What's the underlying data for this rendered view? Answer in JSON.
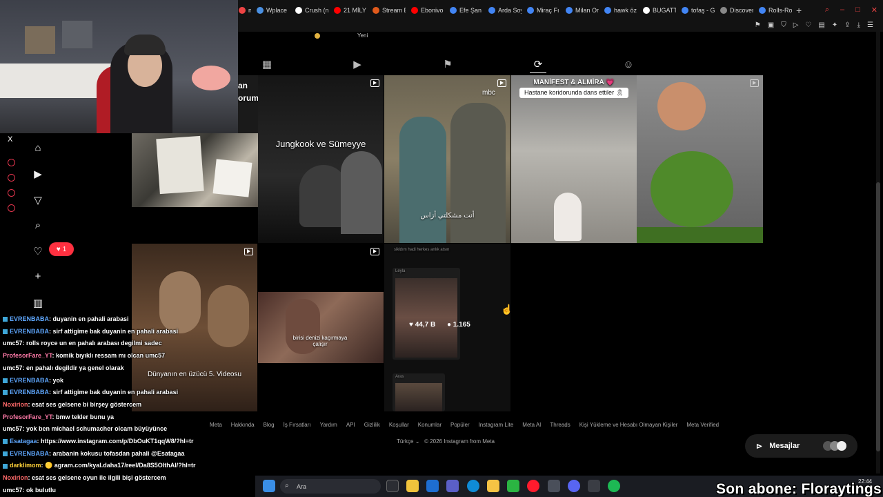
{
  "browser": {
    "tabs": [
      {
        "label": "na S",
        "color": "#e44"
      },
      {
        "label": "Wplace",
        "color": "#4a90e2"
      },
      {
        "label": "Crush (n",
        "color": "#fff"
      },
      {
        "label": "21 MİLY",
        "color": "#f00"
      },
      {
        "label": "Stream E",
        "color": "#e05a1c"
      },
      {
        "label": "Ebonivo",
        "color": "#f00"
      },
      {
        "label": "Efe Şan",
        "color": "#4285f4"
      },
      {
        "label": "Arda Soy",
        "color": "#4285f4"
      },
      {
        "label": "Miraç Fı",
        "color": "#4285f4"
      },
      {
        "label": "Milan Or",
        "color": "#4285f4"
      },
      {
        "label": "hawk öz",
        "color": "#4285f4"
      },
      {
        "label": "BUGATT",
        "color": "#fff"
      },
      {
        "label": "tofaş - G",
        "color": "#4285f4"
      },
      {
        "label": "Discover",
        "color": "#888"
      },
      {
        "label": "Rolls-Ro",
        "color": "#4285f4"
      }
    ],
    "new_tab": "+"
  },
  "instagram": {
    "story_label": "Yeni",
    "profile_tabs": [
      {
        "name": "posts",
        "icon": "▦"
      },
      {
        "name": "reels",
        "icon": "▶"
      },
      {
        "name": "saved",
        "icon": "⚑"
      },
      {
        "name": "reposts",
        "icon": "⟳"
      },
      {
        "name": "tagged",
        "icon": "☺"
      }
    ],
    "posts": {
      "p2_caption": "Jungkook ve Sümeyye",
      "p3_logo": "mbc",
      "p3_caption": "أنت مشكلتي أزاس",
      "p4_caption_title": "MANİFEST & ALMİRA 💗",
      "p4_caption_sub": "Hastane koridorunda dans ettiler 🎗",
      "p6_caption": "birisi denizi kaçırmaya çalışır",
      "p7_overlay": "Dünyanın en üzücü 5. Videosu",
      "p8_header": "sikldım hadi herkes anlık atsın",
      "p8_user": "Leyla",
      "p8_likes": "44,7 B",
      "p8_comments": "1.165",
      "p9_user": "Aras",
      "p1_text_a": "an",
      "p1_text_b": "orum"
    },
    "footer_links": [
      "Meta",
      "Hakkında",
      "Blog",
      "İş Fırsatları",
      "Yardım",
      "API",
      "Gizlilik",
      "Koşullar",
      "Konumlar",
      "Popüler",
      "Instagram Lite",
      "Meta AI",
      "Threads",
      "Kişi Yükleme ve Hesabı Olmayan Kişiler",
      "Meta Verified"
    ],
    "footer_lang": "Türkçe",
    "footer_copyright": "© 2026 Instagram from Meta",
    "messages_label": "Mesajlar",
    "notif_count": "1",
    "close_x": "X"
  },
  "chat": [
    {
      "user": "EVRENBABA",
      "msg": ": duyanin en pahali arabasi",
      "cls": "u-blue",
      "badge": true
    },
    {
      "user": "EVRENBABA",
      "msg": ": sirf attigime bak duyanin en pahali arabasi",
      "cls": "u-blue",
      "badge": true
    },
    {
      "user": "umc57",
      "msg": ": rolls royce un en pahalı arabası degilmi sadec",
      "cls": "u-white",
      "badge": false
    },
    {
      "user": "ProfesorFare_YT",
      "msg": ": komik bıyıklı ressam mı olcan umc57",
      "cls": "u-pink",
      "badge": false
    },
    {
      "user": "umc57",
      "msg": ": en pahalı degildir ya genel olarak",
      "cls": "u-white",
      "badge": false
    },
    {
      "user": "EVRENBABA",
      "msg": ": yok",
      "cls": "u-blue",
      "badge": true
    },
    {
      "user": "EVRENBABA",
      "msg": ": sirf attigime bak duyanin en pahali arabasi",
      "cls": "u-blue",
      "badge": true
    },
    {
      "user": "Noxirion",
      "msg": ": esat ses gelsene bi birşey göstercem",
      "cls": "u-red",
      "badge": false
    },
    {
      "user": "ProfesorFare_YT",
      "msg": ": bmw tekler bunu ya",
      "cls": "u-pink",
      "badge": false
    },
    {
      "user": "umc57",
      "msg": ": yok ben michael schumacher olcam büyüyünce",
      "cls": "u-white",
      "badge": false
    },
    {
      "user": "Esatagaa",
      "msg": ": https://www.instagram.com/p/DbOuKT1qqW8/?hl=tr",
      "cls": "u-blue",
      "badge": true
    },
    {
      "user": "EVRENBABA",
      "msg": ": arabanin kokusu tofasdan pahali @Esatagaa",
      "cls": "u-blue",
      "badge": true
    },
    {
      "user": "darklimom",
      "msg": ": 🟡 agram.com/kyal.daha17/reel/Da8S5OIthAl/?hl=tr",
      "cls": "u-yellow",
      "badge": true
    },
    {
      "user": "Noxirion",
      "msg": ": esat ses gelsene oyun ile ilgili bişi göstercem",
      "cls": "u-red",
      "badge": false
    },
    {
      "user": "umc57",
      "msg": ": ok bulutlu",
      "cls": "u-white",
      "badge": false
    }
  ],
  "taskbar": {
    "search_placeholder": "Ara",
    "clock_time": "22:44"
  },
  "stream_overlay": "Son abone: Floraytings",
  "colors": {
    "instagram_like": "#ff3040",
    "chat_blue": "#5fa8ff",
    "chat_pink": "#ff7aa8"
  }
}
